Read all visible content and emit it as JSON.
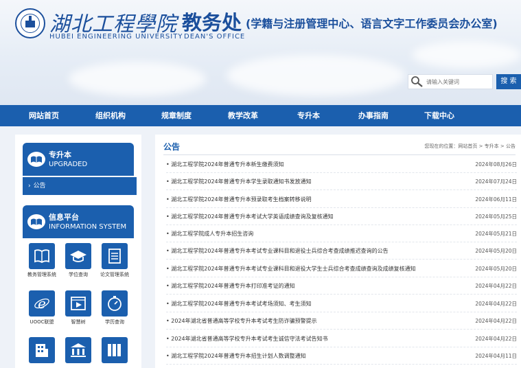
{
  "header": {
    "uni_name_cn": "湖北工程學院",
    "uni_name_en": "HUBEI ENGINEERING UNIVERSITY",
    "office_name": "教务处",
    "office_sub": "(学籍与注册管理中心、语言文字工作委员会办公室)",
    "office_en": "DEAN'S OFFICE"
  },
  "search": {
    "placeholder": "请输入关键词",
    "button_label": "搜 索"
  },
  "nav": [
    "网站首页",
    "组织机构",
    "规章制度",
    "教学改革",
    "专升本",
    "办事指南",
    "下载中心"
  ],
  "sidebar": {
    "panel1": {
      "title_cn": "专升本",
      "title_en": "UPGRADED",
      "items": [
        "公告"
      ]
    },
    "panel2": {
      "title_cn": "信息平台",
      "title_en": "INFORMATION SYSTEM",
      "tiles": [
        {
          "label": "教务管理系统",
          "icon": "book-icon"
        },
        {
          "label": "学位查询",
          "icon": "graduation-cap-icon"
        },
        {
          "label": "论文管理系统",
          "icon": "document-list-icon"
        },
        {
          "label": "UOOC联盟",
          "icon": "ie-browser-icon"
        },
        {
          "label": "智慧树",
          "icon": "video-icon"
        },
        {
          "label": "学历查询",
          "icon": "compass-icon"
        },
        {
          "label": "",
          "icon": "building-icon"
        },
        {
          "label": "",
          "icon": "bank-icon"
        },
        {
          "label": "",
          "icon": "books-icon"
        }
      ]
    }
  },
  "main": {
    "title": "公告",
    "breadcrumb": {
      "prefix": "您现在的位置：",
      "items": [
        "网站首页",
        "专升本",
        "公告"
      ],
      "sep": " > "
    },
    "news": [
      {
        "title": "• 湖北工程学院2024年普通专升本新生缴费须知",
        "date": "2024年08月26日"
      },
      {
        "title": "• 湖北工程学院2024年普通专升本学生录取通知书发放通知",
        "date": "2024年07月24日"
      },
      {
        "title": "• 湖北工程学院2024年普通专升本预录取考生档案转移说明",
        "date": "2024年06月11日"
      },
      {
        "title": "• 湖北工程学院2024年普通专升本考试大学英语成绩查询及复核通知",
        "date": "2024年05月25日"
      },
      {
        "title": "• 湖北工程学院成人专升本招生咨询",
        "date": "2024年05月21日"
      },
      {
        "title": "• 湖北工程学院2024年普通专升本考试专业课科目和退役士兵综合考查成绩推迟查询的公告",
        "date": "2024年05月20日"
      },
      {
        "title": "• 湖北工程学院2024年普通专升本考试专业课科目和退役大学生士兵综合考查成绩查询及成绩复核通知",
        "date": "2024年05月20日"
      },
      {
        "title": "• 湖北工程学院2024年普通专升本打印准考证的通知",
        "date": "2024年04月22日"
      },
      {
        "title": "• 湖北工程学院2024年普通专升本考试考场须知、考生须知",
        "date": "2024年04月22日"
      },
      {
        "title": "• 2024年湖北省普通高等学校专升本考试考生防诈骗预警提示",
        "date": "2024年04月22日"
      },
      {
        "title": "• 2024年湖北省普通高等学校专升本考试考生诚信守法考试告知书",
        "date": "2024年04月22日"
      },
      {
        "title": "• 湖北工程学院2024年普通专升本招生计划人数调整通知",
        "date": "2024年04月11日"
      }
    ]
  },
  "colors": {
    "primary": "#1b5fae",
    "header_text": "#1b4f9c"
  }
}
